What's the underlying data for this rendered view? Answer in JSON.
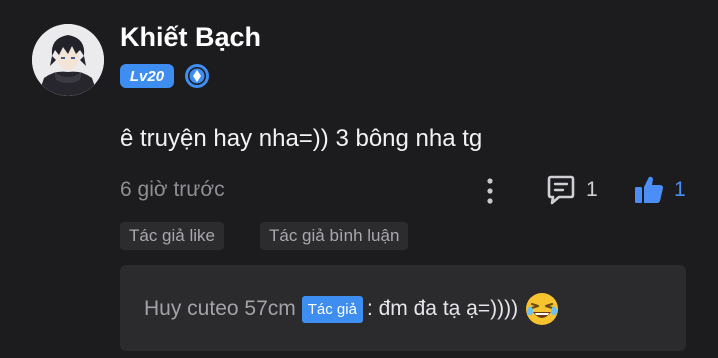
{
  "comment": {
    "username": "Khiết Bạch",
    "level_badge": "Lv20",
    "text": "ê truyện hay nha=)) 3 bông nha tg",
    "timestamp": "6 giờ trước",
    "reply_count": "1",
    "like_count": "1",
    "tags": [
      "Tác giả like",
      "Tác giả bình luận"
    ]
  },
  "reply": {
    "author": "Huy cuteo 57cm",
    "author_badge": "Tác giả",
    "text": ": đm đa tạ ạ=))))"
  },
  "icons": {
    "avatar": "anime-avatar",
    "rank": "diamond-rank-icon",
    "more": "more-vertical-icon",
    "reply": "comment-icon",
    "like": "thumbs-up-icon",
    "emoji": "laughing-emoji-icon"
  },
  "colors": {
    "background": "#1c1c1e",
    "accent": "#3d8ef0",
    "like": "#4c8ef7",
    "tag_bg": "#2c2c2f",
    "reply_bg": "#2b2b2e"
  }
}
